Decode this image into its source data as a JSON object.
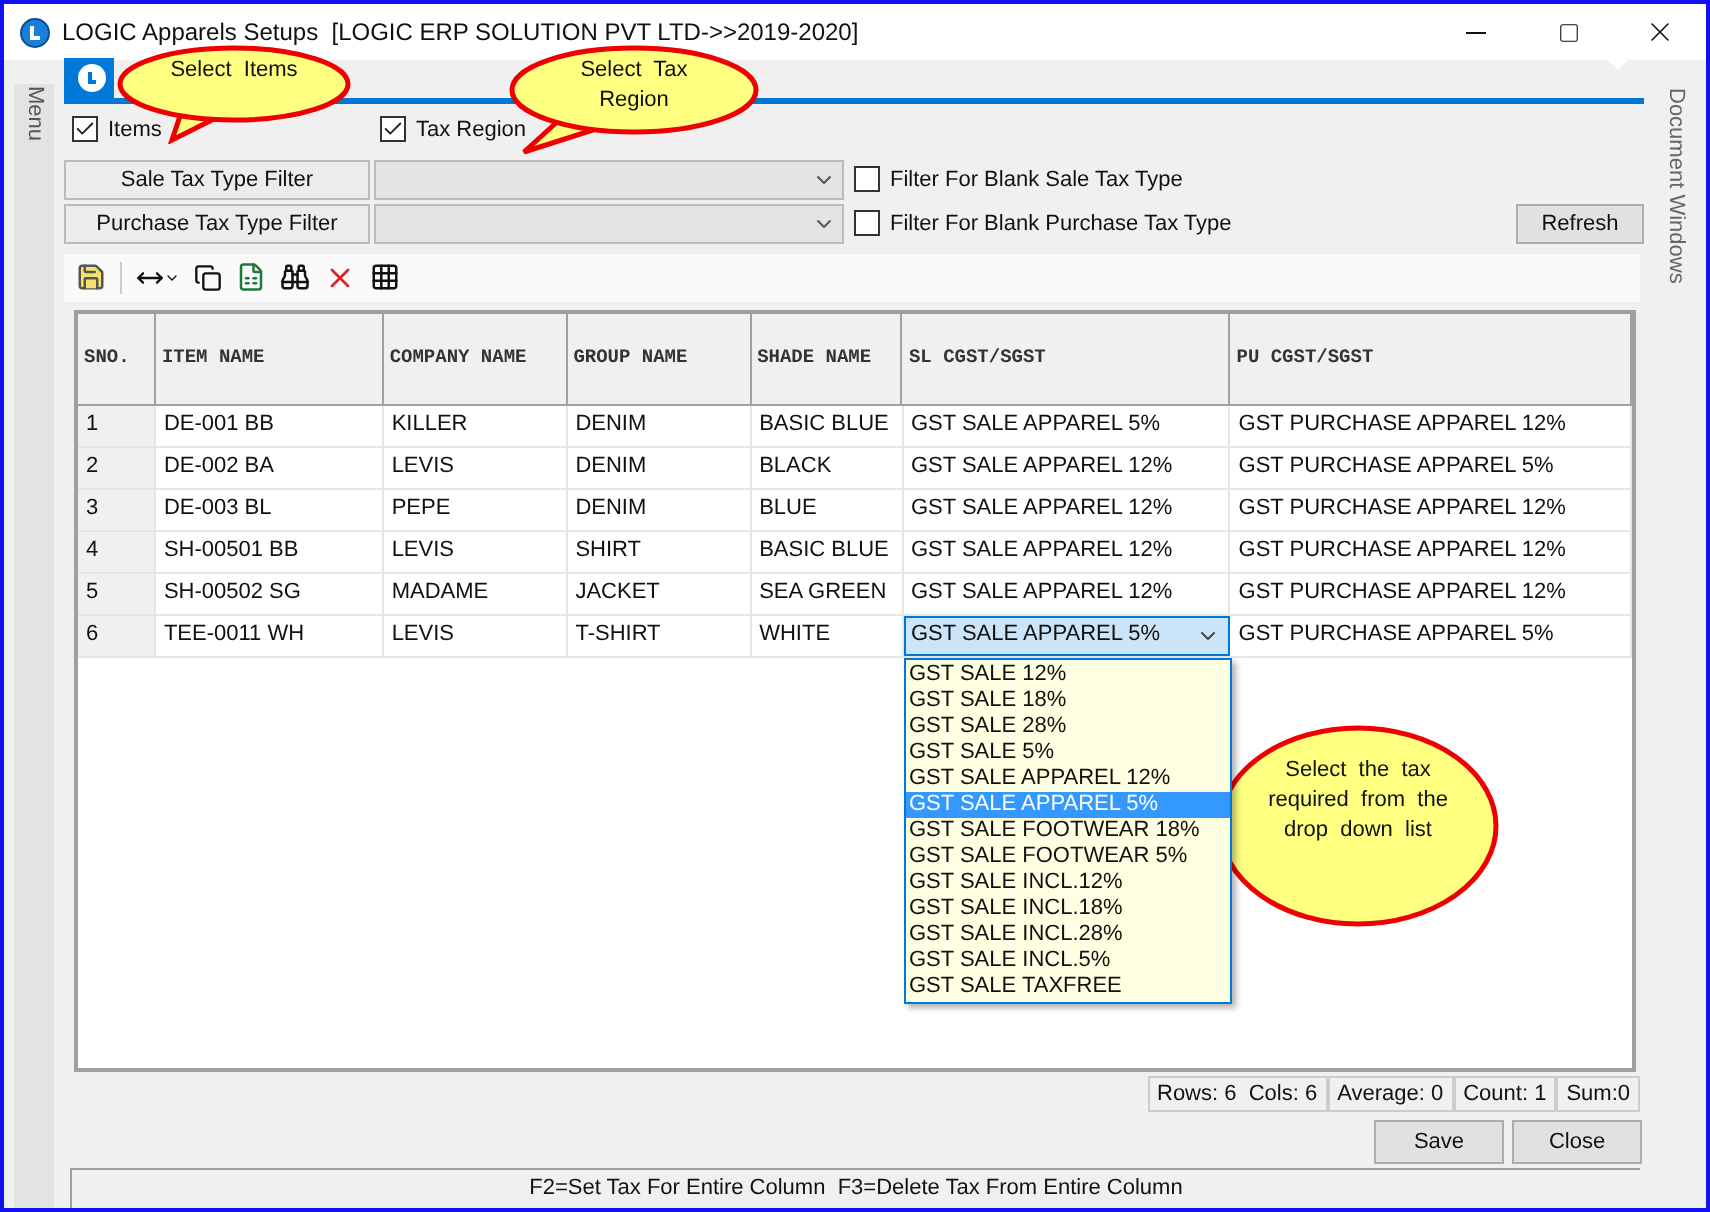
{
  "window": {
    "title": "LOGIC Apparels Setups  [LOGIC ERP SOLUTION PVT LTD->>2019-2020]"
  },
  "left_panel": {
    "label": "Menu"
  },
  "right_panel": {
    "label": "Document Windows"
  },
  "options": [
    {
      "label": "Items",
      "checked": true
    },
    {
      "label": "Tax Region",
      "checked": true
    }
  ],
  "filters": [
    {
      "label": "Sale Tax Type Filter",
      "checkbox_label": "Filter For Blank Sale Tax Type",
      "checked": false
    },
    {
      "label": "Purchase Tax Type Filter",
      "checkbox_label": "Filter For Blank Purchase Tax Type",
      "checked": false
    }
  ],
  "refresh_button": "Refresh",
  "table": {
    "columns": [
      "SNO.",
      "ITEM NAME",
      "COMPANY NAME",
      "GROUP NAME",
      "SHADE NAME",
      "SL CGST/SGST",
      "PU CGST/SGST"
    ],
    "rows": [
      {
        "cells": [
          {
            "kind": "text",
            "text": "1"
          },
          {
            "kind": "text",
            "text": "DE-001 BB"
          },
          {
            "kind": "text",
            "text": "KILLER"
          },
          {
            "kind": "text",
            "text": "DENIM"
          },
          {
            "kind": "text",
            "text": "BASIC BLUE"
          },
          {
            "kind": "text",
            "text": "GST SALE APPAREL 5%"
          },
          {
            "kind": "text",
            "text": "GST PURCHASE APPAREL 12%"
          }
        ]
      },
      {
        "cells": [
          {
            "kind": "text",
            "text": "2"
          },
          {
            "kind": "text",
            "text": "DE-002 BA"
          },
          {
            "kind": "text",
            "text": "LEVIS"
          },
          {
            "kind": "text",
            "text": "DENIM"
          },
          {
            "kind": "text",
            "text": "BLACK"
          },
          {
            "kind": "text",
            "text": "GST SALE APPAREL 12%"
          },
          {
            "kind": "text",
            "text": "GST PURCHASE APPAREL 5%"
          }
        ]
      },
      {
        "cells": [
          {
            "kind": "text",
            "text": "3"
          },
          {
            "kind": "text",
            "text": "DE-003 BL"
          },
          {
            "kind": "text",
            "text": "PEPE"
          },
          {
            "kind": "text",
            "text": "DENIM"
          },
          {
            "kind": "text",
            "text": "BLUE"
          },
          {
            "kind": "text",
            "text": "GST SALE APPAREL 12%"
          },
          {
            "kind": "text",
            "text": "GST PURCHASE APPAREL 12%"
          }
        ]
      },
      {
        "cells": [
          {
            "kind": "text",
            "text": "4"
          },
          {
            "kind": "text",
            "text": "SH-00501 BB"
          },
          {
            "kind": "text",
            "text": "LEVIS"
          },
          {
            "kind": "text",
            "text": "SHIRT"
          },
          {
            "kind": "text",
            "text": "BASIC BLUE"
          },
          {
            "kind": "text",
            "text": "GST SALE APPAREL 12%"
          },
          {
            "kind": "text",
            "text": "GST PURCHASE APPAREL 12%"
          }
        ]
      },
      {
        "cells": [
          {
            "kind": "text",
            "text": "5"
          },
          {
            "kind": "text",
            "text": "SH-00502 SG"
          },
          {
            "kind": "text",
            "text": "MADAME"
          },
          {
            "kind": "text",
            "text": "JACKET"
          },
          {
            "kind": "text",
            "text": "SEA GREEN"
          },
          {
            "kind": "text",
            "text": "GST SALE APPAREL 12%"
          },
          {
            "kind": "text",
            "text": "GST PURCHASE APPAREL 12%"
          }
        ]
      },
      {
        "cells": [
          {
            "kind": "text",
            "text": "6"
          },
          {
            "kind": "text",
            "text": "TEE-0011 WH"
          },
          {
            "kind": "text",
            "text": "LEVIS"
          },
          {
            "kind": "text",
            "text": "T-SHIRT"
          },
          {
            "kind": "text",
            "text": "WHITE"
          },
          {
            "kind": "combo",
            "text": "GST SALE APPAREL 5%",
            "options": [
              {
                "label": "GST SALE 12%",
                "selected": false
              },
              {
                "label": "GST SALE 18%",
                "selected": false
              },
              {
                "label": "GST SALE 28%",
                "selected": false
              },
              {
                "label": "GST SALE 5%",
                "selected": false
              },
              {
                "label": "GST SALE APPAREL 12%",
                "selected": false
              },
              {
                "label": "GST SALE APPAREL 5%",
                "selected": true
              },
              {
                "label": "GST SALE FOOTWEAR 18%",
                "selected": false
              },
              {
                "label": "GST SALE FOOTWEAR 5%",
                "selected": false
              },
              {
                "label": "GST SALE INCL.12%",
                "selected": false
              },
              {
                "label": "GST SALE INCL.18%",
                "selected": false
              },
              {
                "label": "GST SALE INCL.28%",
                "selected": false
              },
              {
                "label": "GST SALE INCL.5%",
                "selected": false
              },
              {
                "label": "GST SALE TAXFREE",
                "selected": false
              }
            ]
          },
          {
            "kind": "text",
            "text": "GST PURCHASE APPAREL 5%"
          }
        ]
      }
    ]
  },
  "status_bar": [
    "Rows: 6  Cols: 6",
    "Average: 0",
    "Count: 1",
    "Sum:0"
  ],
  "buttons": [
    "Save",
    "Close"
  ],
  "hint_bar": "F2=Set Tax For Entire Column  F3=Delete Tax From Entire Column",
  "callouts": [
    {
      "text": "Select  Items"
    },
    {
      "text": "Select  Tax Region"
    },
    {
      "text": "Select  the  tax required  from  the drop  down  list"
    }
  ]
}
